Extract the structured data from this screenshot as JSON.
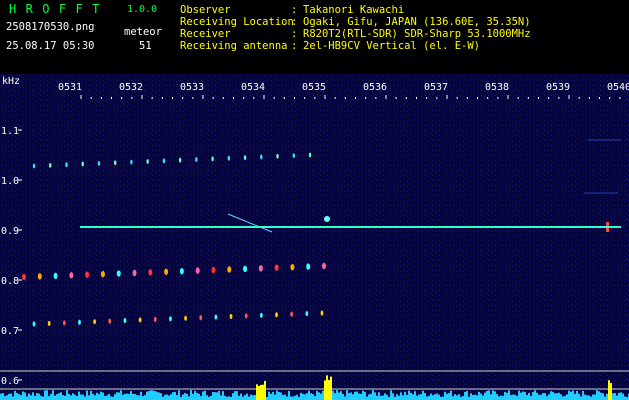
{
  "app": {
    "name": "HROFFT",
    "version": "1.0.0"
  },
  "file": {
    "name": "2508170530.png",
    "timestamp": "25.08.17 05:30"
  },
  "meteor": {
    "label": "meteor",
    "count": "51"
  },
  "info": [
    {
      "label": "Observer",
      "value": "Takanori Kawachi"
    },
    {
      "label": "Receiving Location",
      "value": "Ogaki, Gifu, JAPAN (136.60E, 35.35N)"
    },
    {
      "label": "Receiver",
      "value": "R820T2(RTL-SDR) SDR-Sharp 53.1000MHz"
    },
    {
      "label": "Receiving antenna",
      "value": "2el-HB9CV Vertical (el. E-W)"
    }
  ],
  "axis": {
    "unit": "kHz",
    "x_ticks": [
      "0531",
      "0532",
      "0533",
      "0534",
      "0535",
      "0536",
      "0537",
      "0538",
      "0539",
      "0540"
    ],
    "y_ticks": [
      "1.1",
      "1.0",
      "0.9",
      "0.8",
      "0.7",
      "0.6"
    ]
  },
  "colors": {
    "bg": "#04043a",
    "carrier": "#33ffcc",
    "text_green": "#00ff44",
    "text_yellow": "#ffff00",
    "meter": "#22ccff",
    "meter_peak": "#ffff00"
  }
}
